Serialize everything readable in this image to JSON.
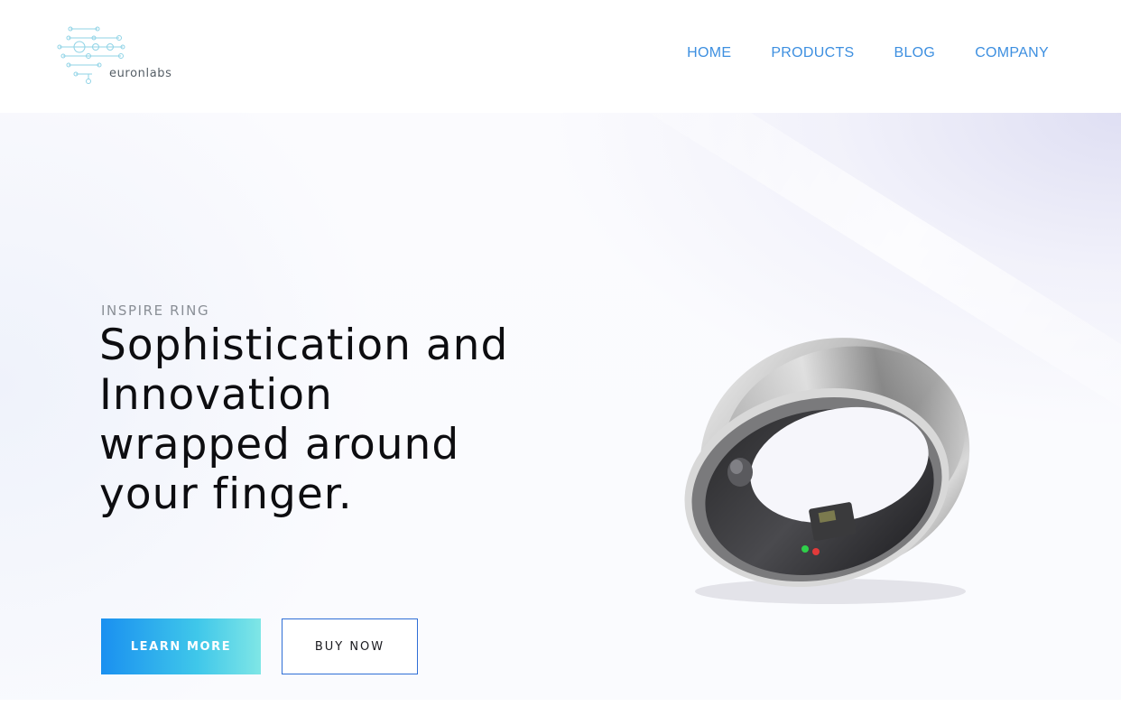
{
  "header": {
    "brand": "euronlabs",
    "logo_icon": "circuit-nodes-logo",
    "nav": [
      {
        "label": "HOME"
      },
      {
        "label": "PRODUCTS"
      },
      {
        "label": "BLOG"
      },
      {
        "label": "COMPANY"
      }
    ]
  },
  "hero": {
    "eyebrow": "INSPIRE RING",
    "headline_lines": [
      "Sophistication and",
      "Innovation",
      "wrapped around",
      "your finger."
    ],
    "primary_button": "LEARN MORE",
    "secondary_button": "BUY NOW",
    "product_image": "smart-ring"
  },
  "colors": {
    "accent_blue": "#3d8fe0",
    "button_gradient_start": "#1a90f0",
    "button_gradient_end": "#7fe6e6",
    "outline_button_border": "#2f6fd6",
    "headline_text": "#0d0d10"
  }
}
